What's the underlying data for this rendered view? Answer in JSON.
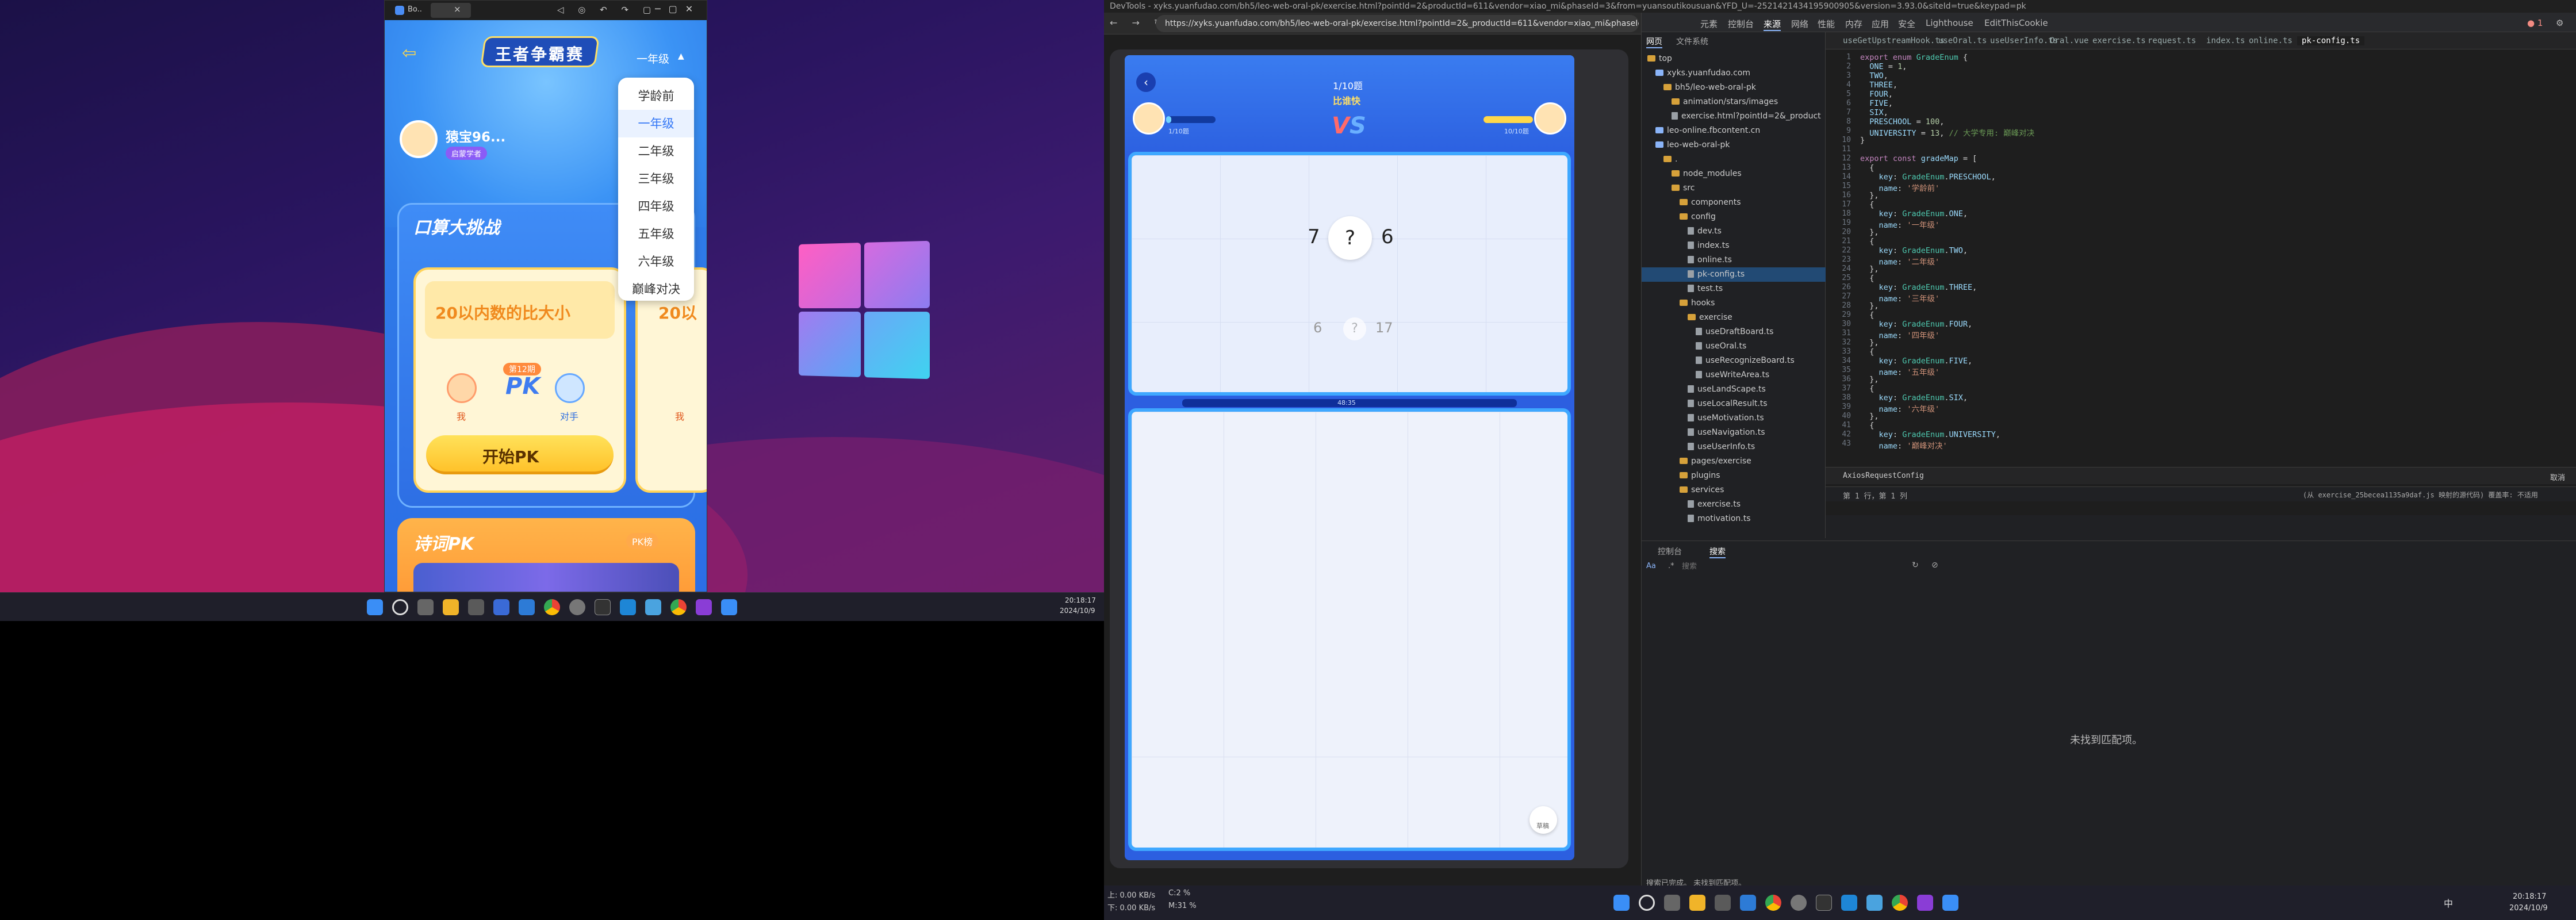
{
  "left": {
    "phone_window": {
      "tab1": "Bo..",
      "tab2": "",
      "header": {
        "back": "back",
        "title_logo": "王者争霸赛",
        "grade_selected": "一年级"
      },
      "user": {
        "name": "猿宝96...",
        "level_badge": "启蒙学者"
      },
      "grade_menu": [
        "学龄前",
        "一年级",
        "二年级",
        "三年级",
        "四年级",
        "五年级",
        "六年级",
        "巅峰对决"
      ],
      "section1": {
        "title": "口算大挑战",
        "card1": {
          "topic": "20以内数的比大小",
          "badge": "第12期",
          "me": "我",
          "vs": "PK",
          "opponent": "对手",
          "button": "开始PK"
        },
        "card2": {
          "topic": "20以",
          "me": "我"
        }
      },
      "section2": {
        "title": "诗词PK",
        "badge": "PK榜"
      }
    },
    "taskbar": {
      "time": "20:18:17",
      "date": "2024/10/9"
    }
  },
  "right": {
    "browser": {
      "tab_text": "DevTools - xyks.yuanfudao.com/bh5/leo-web-oral-pk/exercise.html?pointId=2&productId=611&vendor=xiao_mi&phaseId=3&from=yuansoutikousuan&YFD_U=-2521421434195900905&version=3.93.0&siteId=true&keypad=pk",
      "url": "https://xyks.yuanfudao.com/bh5/leo-web-oral-pk/exercise.html?pointId=2&_productId=611&vendor=xiao_mi&phaseId=3&f"
    },
    "game": {
      "progress": "1/10题",
      "mode": "比谁快",
      "my_score": "1/10题",
      "opp_score": "10/10题",
      "question": {
        "left": "7",
        "mark": "?",
        "right": "6"
      },
      "prev": {
        "left": "6",
        "mark": "?",
        "right": "17"
      },
      "timer": "48:35",
      "draft_label": "草稿"
    },
    "devtools": {
      "top_tabs": [
        "元素",
        "控制台",
        "来源",
        "网络",
        "性能",
        "内存",
        "应用",
        "安全",
        "Lighthouse",
        "EditThisCookie"
      ],
      "active_tab": "来源",
      "nav_tabs": [
        "网页",
        "文件系统"
      ],
      "editor_tabs": [
        "useGetUpstreamHook.ts",
        "useOral.ts",
        "useUserInfo.ts",
        "Oral.vue",
        "exercise.ts",
        "request.ts",
        "index.ts",
        "online.ts",
        "pk-config.ts"
      ],
      "active_file": "pk-config.ts",
      "tree": [
        {
          "d": 0,
          "t": "f",
          "n": "top"
        },
        {
          "d": 1,
          "t": "c",
          "n": "xyks.yuanfudao.com"
        },
        {
          "d": 2,
          "t": "f",
          "n": "bh5/leo-web-oral-pk"
        },
        {
          "d": 3,
          "t": "f",
          "n": "animation/stars/images"
        },
        {
          "d": 3,
          "t": "x",
          "n": "exercise.html?pointId=2&_product"
        },
        {
          "d": 1,
          "t": "c",
          "n": "leo-online.fbcontent.cn"
        },
        {
          "d": 1,
          "t": "c",
          "n": "leo-web-oral-pk"
        },
        {
          "d": 2,
          "t": "f",
          "n": "."
        },
        {
          "d": 3,
          "t": "f",
          "n": "node_modules"
        },
        {
          "d": 3,
          "t": "f",
          "n": "src"
        },
        {
          "d": 4,
          "t": "f",
          "n": "components"
        },
        {
          "d": 4,
          "t": "f",
          "n": "config"
        },
        {
          "d": 5,
          "t": "x",
          "n": "dev.ts"
        },
        {
          "d": 5,
          "t": "x",
          "n": "index.ts"
        },
        {
          "d": 5,
          "t": "x",
          "n": "online.ts"
        },
        {
          "d": 5,
          "t": "x",
          "n": "pk-config.ts",
          "sel": true
        },
        {
          "d": 5,
          "t": "x",
          "n": "test.ts"
        },
        {
          "d": 4,
          "t": "f",
          "n": "hooks"
        },
        {
          "d": 5,
          "t": "f",
          "n": "exercise"
        },
        {
          "d": 6,
          "t": "x",
          "n": "useDraftBoard.ts"
        },
        {
          "d": 6,
          "t": "x",
          "n": "useOral.ts"
        },
        {
          "d": 6,
          "t": "x",
          "n": "useRecognizeBoard.ts"
        },
        {
          "d": 6,
          "t": "x",
          "n": "useWriteArea.ts"
        },
        {
          "d": 5,
          "t": "x",
          "n": "useLandScape.ts"
        },
        {
          "d": 5,
          "t": "x",
          "n": "useLocalResult.ts"
        },
        {
          "d": 5,
          "t": "x",
          "n": "useMotivation.ts"
        },
        {
          "d": 5,
          "t": "x",
          "n": "useNavigation.ts"
        },
        {
          "d": 5,
          "t": "x",
          "n": "useUserInfo.ts"
        },
        {
          "d": 4,
          "t": "f",
          "n": "pages/exercise"
        },
        {
          "d": 4,
          "t": "f",
          "n": "plugins"
        },
        {
          "d": 4,
          "t": "f",
          "n": "services"
        },
        {
          "d": 5,
          "t": "x",
          "n": "exercise.ts"
        },
        {
          "d": 5,
          "t": "x",
          "n": "motivation.ts"
        }
      ],
      "status_line": "第 1 行，第 1 列",
      "status_right": "(从 exercise_25becea1135a9daf.js 映射的源代码) 覆盖率: 不适用",
      "axios_label": "AxiosRequestConfig",
      "cancel": "取消",
      "bottom_tabs": [
        "控制台",
        "搜索"
      ],
      "search_placeholder": "搜索",
      "no_match": "未找到匹配项。",
      "search_done": "搜索已完成。 未找到匹配项。"
    },
    "statusbar": {
      "net1": "上: 0.00 KB/s",
      "net2": "下: 0.00 KB/s",
      "cpu": "C:2 %",
      "mem": "M:31 %",
      "ime": "中",
      "time": "20:18:17",
      "date": "2024/10/9"
    }
  }
}
